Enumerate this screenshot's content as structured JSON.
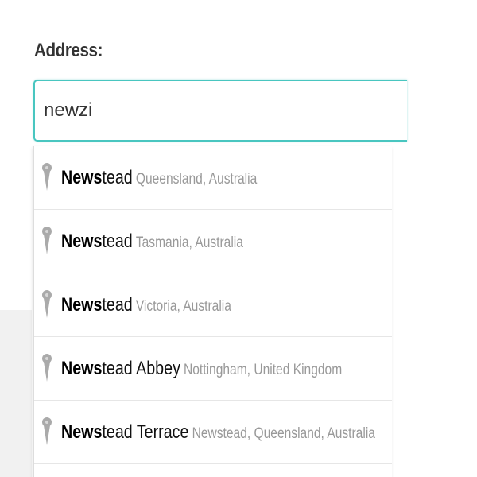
{
  "form": {
    "label": "Address:",
    "input_value": "newzi"
  },
  "autocomplete": {
    "pin_icon_color": "#aaaaaa",
    "focus_border_color": "#49c6c0",
    "items": [
      {
        "match": "News",
        "rest": "tead",
        "secondary": "Queensland, Australia"
      },
      {
        "match": "News",
        "rest": "tead",
        "secondary": "Tasmania, Australia"
      },
      {
        "match": "News",
        "rest": "tead",
        "secondary": "Victoria, Australia"
      },
      {
        "match": "News",
        "rest": "tead Abbey",
        "secondary": "Nottingham, United Kingdom"
      },
      {
        "match": "News",
        "rest": "tead Terrace",
        "secondary": "Newstead, Queensland, Australia"
      }
    ]
  }
}
